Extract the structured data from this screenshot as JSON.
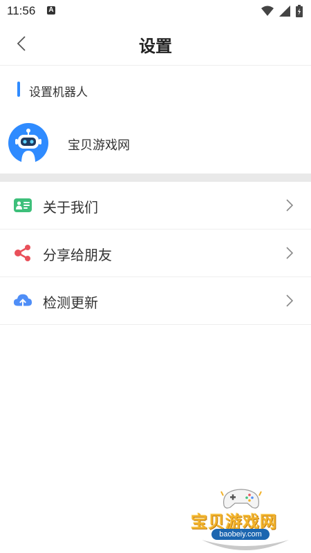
{
  "status_bar": {
    "time": "11:56",
    "notification_letter": "A",
    "icons": [
      "wifi-icon",
      "signal-icon",
      "battery-icon"
    ]
  },
  "header": {
    "title": "设置",
    "back_icon": "chevron-left-icon"
  },
  "section": {
    "title": "设置机器人",
    "accent_color": "#2f8bff"
  },
  "robot": {
    "name": "宝贝游戏网",
    "avatar_icon": "robot-icon",
    "avatar_color": "#2f8bff"
  },
  "menu": {
    "items": [
      {
        "label": "关于我们",
        "icon": "id-card-icon",
        "icon_color": "#3dbf7a"
      },
      {
        "label": "分享给朋友",
        "icon": "share-icon",
        "icon_color": "#e9505a"
      },
      {
        "label": "检测更新",
        "icon": "cloud-upload-icon",
        "icon_color": "#4f8ef7"
      }
    ]
  },
  "watermark": {
    "title": "宝贝游戏网",
    "url": "baobeiy.com"
  }
}
